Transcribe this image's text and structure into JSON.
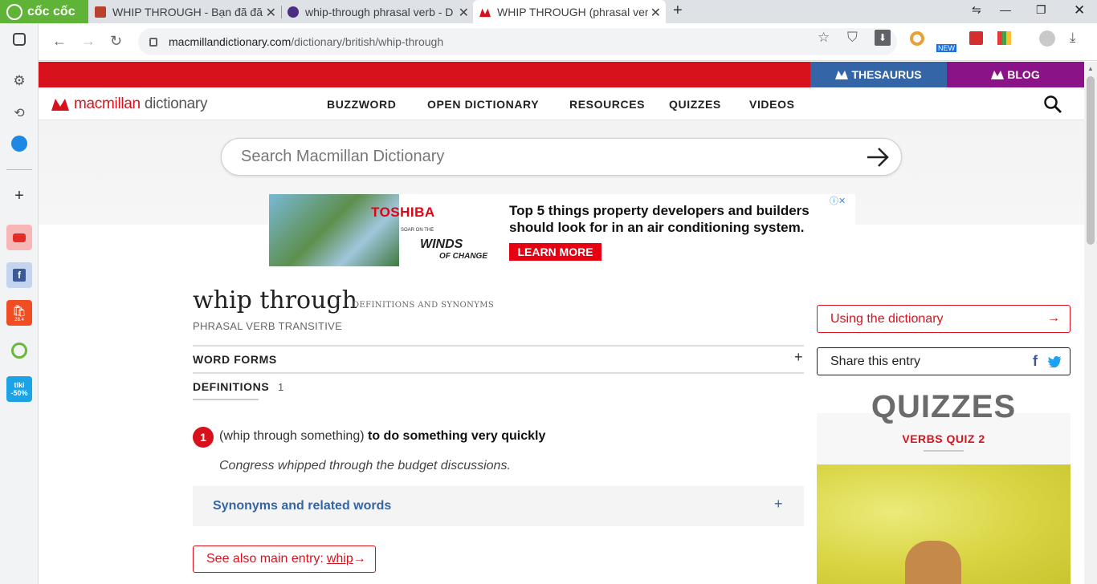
{
  "browser": {
    "brand": "cốc cốc",
    "tabs": [
      {
        "title": "WHIP THROUGH - Bạn đã đăn",
        "active": false
      },
      {
        "title": "whip-through phrasal verb - D",
        "active": false
      },
      {
        "title": "WHIP THROUGH (phrasal ver",
        "active": true
      }
    ],
    "url_host": "macmillandictionary.com",
    "url_path": "/dictionary/british/whip-through",
    "ext_badge": "NEW"
  },
  "sidebar": {
    "shopee_badge": "28.4",
    "tiki_label": "tiki",
    "tiki_badge": "-50%"
  },
  "topbar": {
    "thesaurus": "THESAURUS",
    "blog": "BLOG"
  },
  "header": {
    "logo_main": "macmillan",
    "logo_sub": "dictionary",
    "nav": [
      "BUZZWORD",
      "OPEN DICTIONARY",
      "RESOURCES",
      "QUIZZES",
      "VIDEOS"
    ]
  },
  "search": {
    "placeholder": "Search Macmillan Dictionary"
  },
  "ad": {
    "brand": "TOSHIBA",
    "tag1": "SOAR ON THE",
    "tag2": "WINDS",
    "tag3": "OF CHANGE",
    "headline": "Top 5 things property developers and builders should look for in an air conditioning system.",
    "cta": "LEARN MORE"
  },
  "entry": {
    "headword": "whip through",
    "subtitle": "DEFINITIONS AND SYNONYMS",
    "pos": "PHRASAL VERB  TRANSITIVE",
    "word_forms": "WORD FORMS",
    "definitions": "DEFINITIONS",
    "def_count": "1",
    "sense_number": "1",
    "sense_pattern": "(whip through something)",
    "sense_def": "to do something very quickly",
    "example": "Congress whipped through the budget discussions.",
    "synonyms": "Synonyms and related words",
    "see_also_prefix": "See also main entry:",
    "see_also_link": "whip"
  },
  "aside": {
    "using": "Using the dictionary",
    "share": "Share this entry",
    "quiz_title": "QUIZZES",
    "quiz_sub": "VERBS QUIZ 2"
  }
}
